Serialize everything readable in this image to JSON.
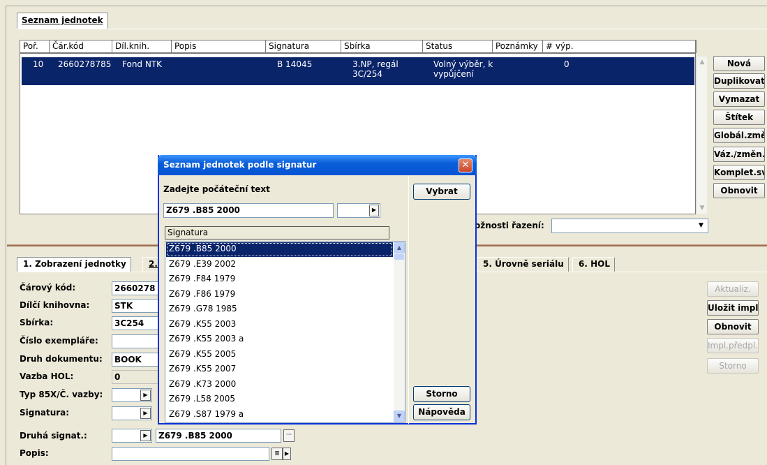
{
  "top_tab": "Seznam jednotek",
  "columns": [
    {
      "label": "Poř.",
      "w": 42
    },
    {
      "label": "Čár.kód",
      "w": 90
    },
    {
      "label": "Díl.knih.",
      "w": 85
    },
    {
      "label": "Popis",
      "w": 135
    },
    {
      "label": "Signatura",
      "w": 108
    },
    {
      "label": "Sbírka",
      "w": 117
    },
    {
      "label": "Status",
      "w": 100
    },
    {
      "label": "Poznámky",
      "w": 72
    },
    {
      "label": "# výp.",
      "w": 219
    }
  ],
  "row": {
    "por": "10",
    "kod": "2660278785",
    "dil": "Fond NTK",
    "popis": "",
    "signatura": "B 14045",
    "sbirka_1": "3.NP, regál",
    "sbirka_2": "3C/254",
    "status_1": "Volný výběr, k",
    "status_2": "vypůjčení",
    "poznamky": "",
    "vyp": "0"
  },
  "side_buttons": [
    "Nová",
    "Duplikovat",
    "Vymazat",
    "Štítek",
    "Globál.změn",
    "Váz./změn.",
    "Komplet.sv.",
    "Obnovit"
  ],
  "sort_label": "ožnosti řazení:",
  "sort_value": "",
  "bottom_tabs": {
    "tab1": "1. Zobrazení jednotky",
    "tab2": "2.",
    "tab5": "5. Úrovně seriálu",
    "tab6": "6. HOL"
  },
  "fields": {
    "carovy_kod_label": "Čárový kód:",
    "carovy_kod_value": "2660278",
    "dilci_label": "Dílčí knihovna:",
    "dilci_value": "STK",
    "sbirka_label": "Sbírka:",
    "sbirka_value": "3C254",
    "cislo_label": "Číslo exempláře:",
    "cislo_value": "",
    "druh_label": "Druh dokumentu:",
    "druh_value": "BOOK",
    "vazba_label": "Vazba HOL:",
    "vazba_value": "0",
    "typ_label": "Typ 85X/Č. vazby:",
    "signatura_label": "Signatura:",
    "druha_label": "Druhá signat.:",
    "druha_value": "Z679 .B85 2000",
    "popis_label": "Popis:"
  },
  "right_buttons": [
    {
      "label": "Aktualiz.",
      "enabled": false
    },
    {
      "label": "Uložit impl.",
      "enabled": true
    },
    {
      "label": "Obnovit",
      "enabled": true
    },
    {
      "label": "Impl.předpl.",
      "enabled": false
    },
    {
      "label": "Storno",
      "enabled": false
    }
  ],
  "dialog": {
    "title": "Seznam jednotek podle signatur",
    "prompt": "Zadejte počáteční text",
    "input_value": "Z679 .B85 2000",
    "list_header": "Signatura",
    "items": [
      "Z679 .B85 2000",
      "Z679 .E39 2002",
      "Z679 .F84 1979",
      "Z679 .F86 1979",
      "Z679 .G78 1985",
      "Z679 .K55 2003",
      "Z679 .K55 2003 a",
      "Z679 .K55 2005",
      "Z679 .K55 2007",
      "Z679 .K73 2000",
      "Z679 .L58 2005",
      "Z679 .S87 1979 a"
    ],
    "btn_select": "Vybrat",
    "btn_cancel": "Storno",
    "btn_help": "Nápověda"
  }
}
